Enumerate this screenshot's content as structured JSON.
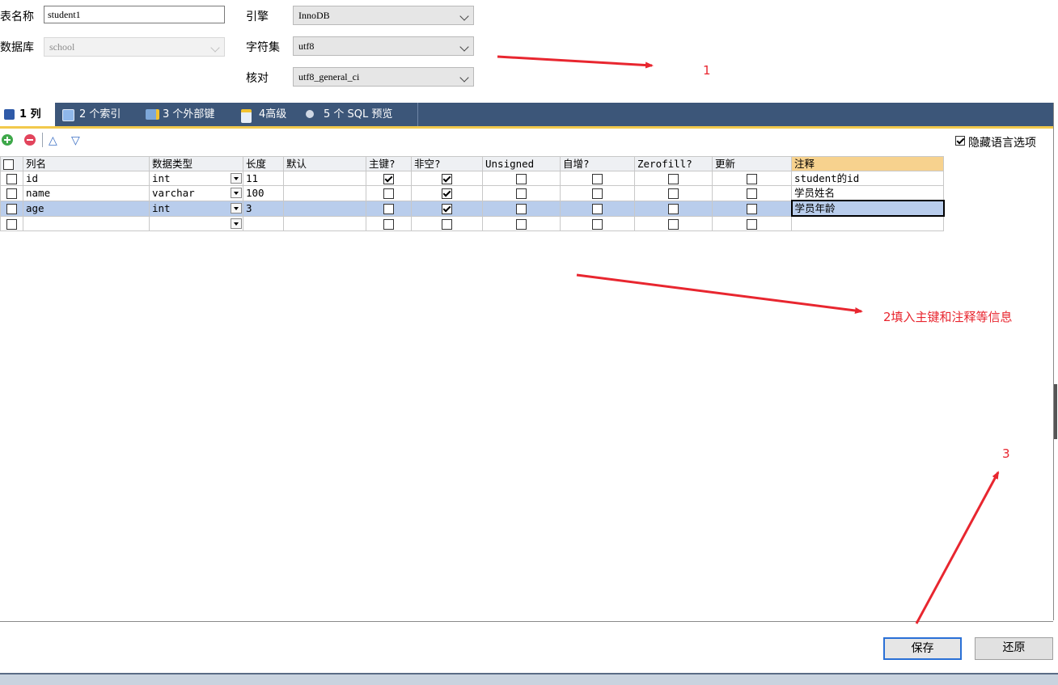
{
  "form": {
    "table_name_label": "表名称",
    "table_name_value": "student1",
    "database_label": "数据库",
    "database_value": "school",
    "engine_label": "引擎",
    "engine_value": "InnoDB",
    "charset_label": "字符集",
    "charset_value": "utf8",
    "collation_label": "核对",
    "collation_value": "utf8_general_ci"
  },
  "tabs": [
    {
      "label": "1 列",
      "active": true,
      "icon": "columns-icon"
    },
    {
      "label": "2 个索引",
      "active": false,
      "icon": "index-icon"
    },
    {
      "label": "3 个外部键",
      "active": false,
      "icon": "foreign-key-icon"
    },
    {
      "label": "4高级",
      "active": false,
      "icon": "advanced-icon"
    },
    {
      "label": "5 个 SQL 预览",
      "active": false,
      "icon": "sql-preview-icon"
    }
  ],
  "toolbar": {
    "hide_language_label": "隐藏语言选项",
    "hide_language_checked": true,
    "icons": [
      "add-row-icon",
      "delete-row-icon",
      "move-up-icon",
      "move-down-icon"
    ]
  },
  "columns_table": {
    "headers": [
      "列名",
      "数据类型",
      "长度",
      "默认",
      "主键?",
      "非空?",
      "Unsigned",
      "自增?",
      "Zerofill?",
      "更新",
      "注释"
    ],
    "rows": [
      {
        "name": "id",
        "type": "int",
        "length": "11",
        "default": "",
        "pk": true,
        "notnull": true,
        "unsigned": false,
        "autoinc": false,
        "zerofill": false,
        "update": false,
        "comment": "student的id"
      },
      {
        "name": "name",
        "type": "varchar",
        "length": "100",
        "default": "",
        "pk": false,
        "notnull": true,
        "unsigned": false,
        "autoinc": false,
        "zerofill": false,
        "update": false,
        "comment": "学员姓名"
      },
      {
        "name": "age",
        "type": "int",
        "length": "3",
        "default": "",
        "pk": false,
        "notnull": true,
        "unsigned": false,
        "autoinc": false,
        "zerofill": false,
        "update": false,
        "comment": "学员年龄"
      },
      {
        "name": "",
        "type": "",
        "length": "",
        "default": "",
        "pk": false,
        "notnull": false,
        "unsigned": false,
        "autoinc": false,
        "zerofill": false,
        "update": false,
        "comment": ""
      }
    ]
  },
  "buttons": {
    "save_label": "保存",
    "revert_label": "还原"
  },
  "annotations": {
    "note1": "1",
    "note2": "2填入主键和注释等信息",
    "note3": "3"
  },
  "colors": {
    "tabbar": "#3c5679",
    "tab_underline": "#f2c94c",
    "selected_row": "#b9cdec",
    "annotation_red": "#e8262f",
    "primary_button_border": "#2a70d6"
  }
}
